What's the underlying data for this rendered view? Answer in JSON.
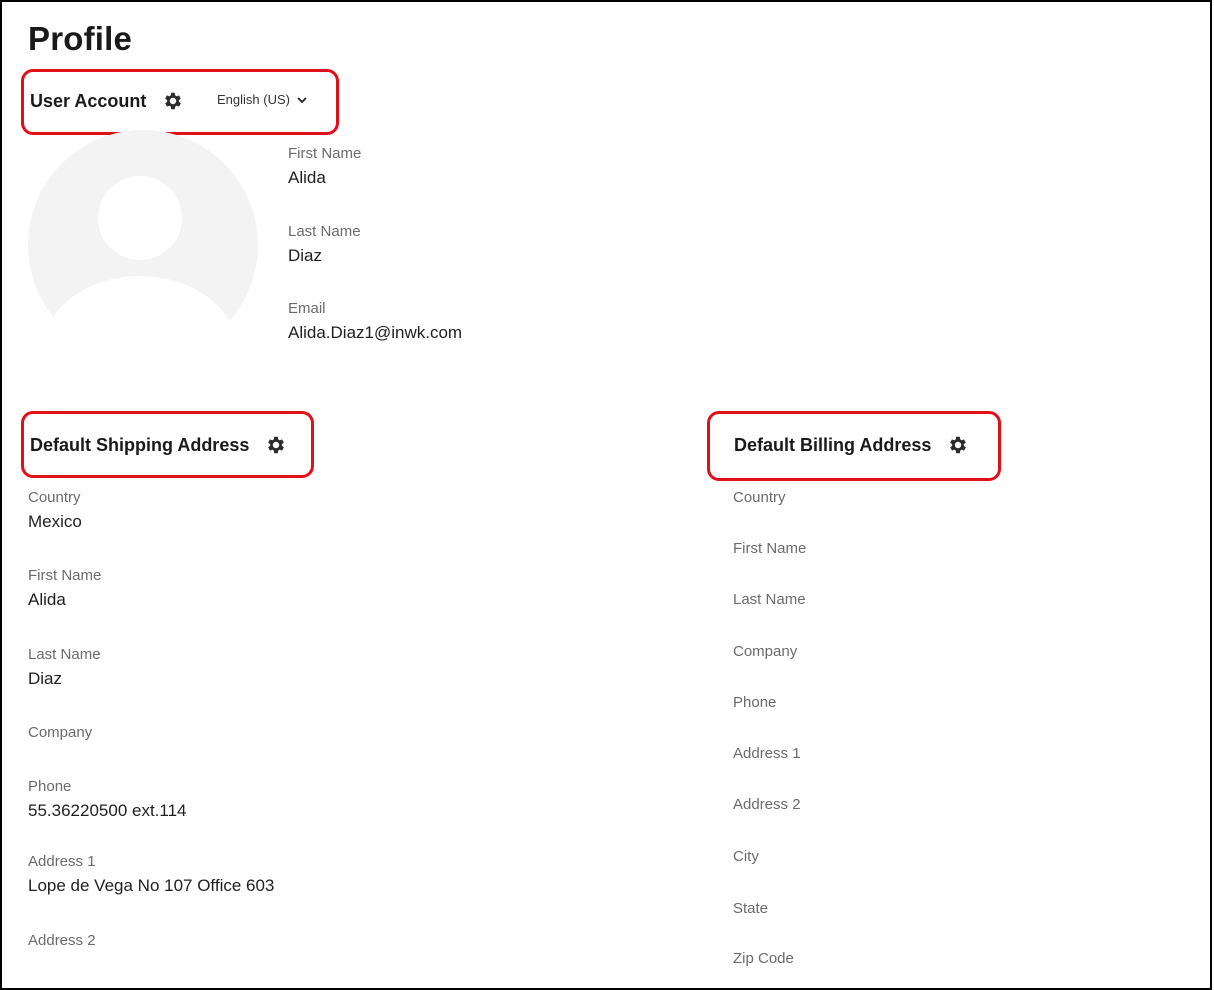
{
  "page": {
    "title": "Profile"
  },
  "user_account": {
    "heading": "User Account",
    "language": "English (US)",
    "fields": [
      {
        "label": "First Name",
        "value": "Alida"
      },
      {
        "label": "Last Name",
        "value": "Diaz"
      },
      {
        "label": "Email",
        "value": "Alida.Diaz1@inwk.com"
      }
    ]
  },
  "shipping": {
    "heading": "Default Shipping Address",
    "fields": [
      {
        "label": "Country",
        "value": "Mexico"
      },
      {
        "label": "First Name",
        "value": "Alida"
      },
      {
        "label": "Last Name",
        "value": "Diaz"
      },
      {
        "label": "Company",
        "value": ""
      },
      {
        "label": "Phone",
        "value": "55.36220500 ext.114"
      },
      {
        "label": "Address 1",
        "value": "Lope de Vega No 107 Office 603"
      },
      {
        "label": "Address 2",
        "value": ""
      }
    ]
  },
  "billing": {
    "heading": "Default Billing Address",
    "fields": [
      {
        "label": "Country"
      },
      {
        "label": "First Name"
      },
      {
        "label": "Last Name"
      },
      {
        "label": "Company"
      },
      {
        "label": "Phone"
      },
      {
        "label": "Address 1"
      },
      {
        "label": "Address 2"
      },
      {
        "label": "City"
      },
      {
        "label": "State"
      },
      {
        "label": "Zip Code"
      }
    ]
  },
  "colors": {
    "highlight": "#e0101a",
    "label_gray": "#6b6b6b",
    "avatar_bg": "#f3f3f3"
  },
  "icons": {
    "settings": "gear-icon",
    "dropdown": "chevron-down-icon",
    "avatar": "user-silhouette"
  }
}
